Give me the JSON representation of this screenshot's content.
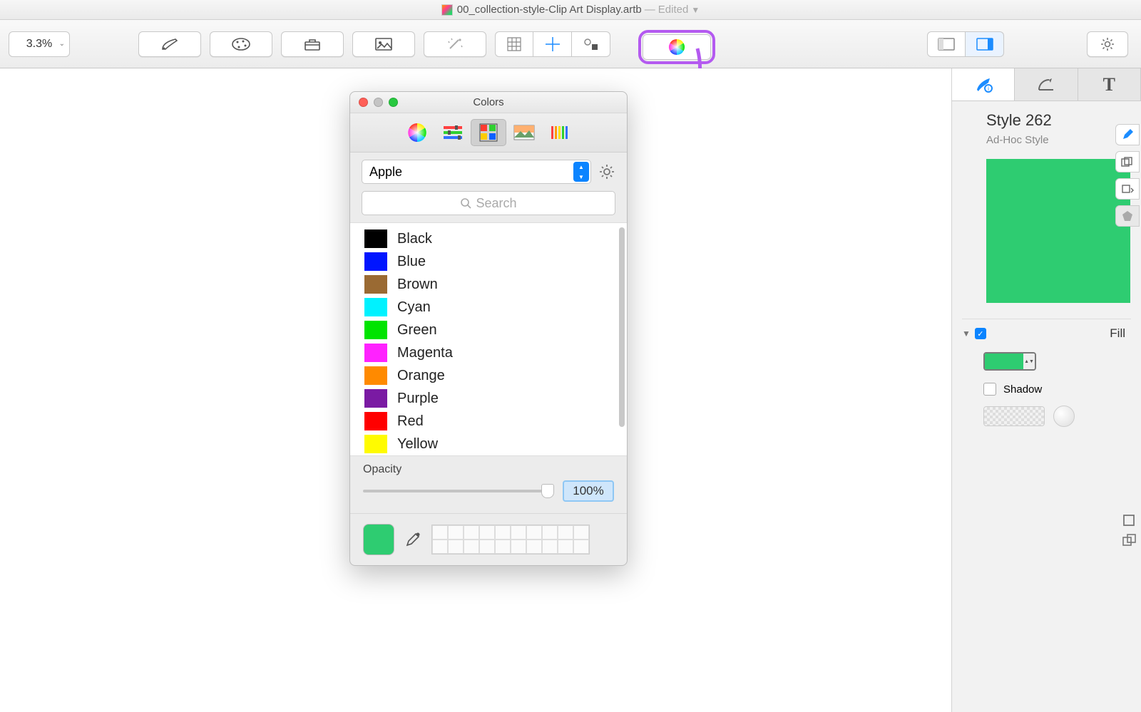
{
  "titlebar": {
    "filename": "00_collection-style-Clip Art Display.artb",
    "status": "Edited"
  },
  "toolbar": {
    "zoom": "3.3%"
  },
  "color_panel": {
    "title": "Colors",
    "palette_select": "Apple",
    "search_placeholder": "Search",
    "colors": [
      {
        "name": "Black",
        "hex": "#000000"
      },
      {
        "name": "Blue",
        "hex": "#0015ff"
      },
      {
        "name": "Brown",
        "hex": "#9a6a33"
      },
      {
        "name": "Cyan",
        "hex": "#00f2ff"
      },
      {
        "name": "Green",
        "hex": "#00e400"
      },
      {
        "name": "Magenta",
        "hex": "#ff22ff"
      },
      {
        "name": "Orange",
        "hex": "#ff8a00"
      },
      {
        "name": "Purple",
        "hex": "#7a1aa3"
      },
      {
        "name": "Red",
        "hex": "#ff0000"
      },
      {
        "name": "Yellow",
        "hex": "#fffb00"
      }
    ],
    "opacity_label": "Opacity",
    "opacity_value": "100%",
    "current_color": "#2ecc71"
  },
  "inspector": {
    "style_name": "Style 262",
    "style_sub": "Ad-Hoc Style",
    "preview_color": "#2ecc71",
    "fill_section": "Fill",
    "shadow_label": "Shadow"
  }
}
